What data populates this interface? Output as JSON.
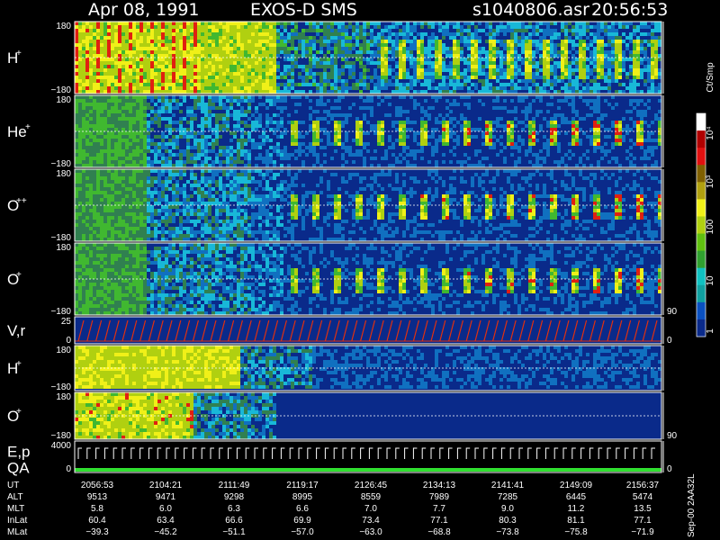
{
  "header": {
    "date": "Apr 08, 1991",
    "instrument": "EXOS-D SMS",
    "file": "s1040806.asr",
    "time": "20:56:53"
  },
  "footer": {
    "version": "Sep-00 2AA32L"
  },
  "colors": {
    "background": "#000000",
    "axis": "#ffffff",
    "panel_bg": "#0a2a8a",
    "cyan": "#18b8d8",
    "green": "#40b830",
    "yellow": "#f0f018",
    "red": "#e02010",
    "vel_trace": "#e03010",
    "flag_green": "#30e030"
  },
  "chart_data": {
    "type": "heatmap",
    "title": "Apr 08, 1991    EXOS-D SMS",
    "panels": [
      {
        "id": "h-plus",
        "label": "H",
        "superscript": "+",
        "ymax": "180",
        "ymin": "−180"
      },
      {
        "id": "he-plus",
        "label": "He",
        "superscript": "+",
        "ymax": "180",
        "ymin": "−180"
      },
      {
        "id": "o-plusplus",
        "label": "O",
        "superscript": "++",
        "ymax": "180",
        "ymin": "−180"
      },
      {
        "id": "o-plus",
        "label": "O",
        "superscript": "+",
        "ymax": "180",
        "ymin": "−180",
        "right_tick": "90"
      },
      {
        "id": "velocity",
        "label": "V,r",
        "ymax": "25",
        "ymin": "0",
        "right_tick": "0"
      },
      {
        "id": "h-plus-2",
        "label": "H",
        "superscript": "+",
        "ymax": "180",
        "ymin": "−180"
      },
      {
        "id": "o-plus-2",
        "label": "O",
        "superscript": "+",
        "ymax": "180",
        "ymin": "−180",
        "right_tick": "90"
      },
      {
        "id": "energy",
        "label": "E,p",
        "label2": "QA",
        "ymax": "4000",
        "ymin": "0",
        "right_tick": "0"
      }
    ],
    "colorbar": {
      "unit": "Ct/Smp",
      "labels": [
        "10⁴",
        "10³",
        "100",
        "10",
        "1"
      ],
      "colors": [
        "#ffffff",
        "#b00000",
        "#e01010",
        "#806000",
        "#b0a010",
        "#f0f018",
        "#b0d010",
        "#60c010",
        "#30a030",
        "#10c0c0",
        "#10a0a0",
        "#0a50c0",
        "#0a2a8a"
      ]
    },
    "orbit_table": {
      "rows": [
        {
          "label": "UT",
          "values": [
            "2056:53",
            "2104:21",
            "2111:49",
            "2119:17",
            "2126:45",
            "2134:13",
            "2141:41",
            "2149:09",
            "2156:37"
          ]
        },
        {
          "label": "ALT",
          "values": [
            "9513",
            "9471",
            "9298",
            "8995",
            "8559",
            "7989",
            "7285",
            "6445",
            "5474"
          ]
        },
        {
          "label": "MLT",
          "values": [
            "5.8",
            "6.0",
            "6.3",
            "6.6",
            "7.0",
            "7.7",
            "9.0",
            "11.2",
            "13.5"
          ]
        },
        {
          "label": "InLat",
          "values": [
            "60.4",
            "63.4",
            "66.6",
            "69.9",
            "73.4",
            "77.1",
            "80.3",
            "81.1",
            "77.1"
          ]
        },
        {
          "label": "MLat",
          "values": [
            "−39.3",
            "−45.2",
            "−51.1",
            "−57.0",
            "−63.0",
            "−68.8",
            "−73.8",
            "−75.8",
            "−71.9"
          ]
        }
      ]
    }
  }
}
